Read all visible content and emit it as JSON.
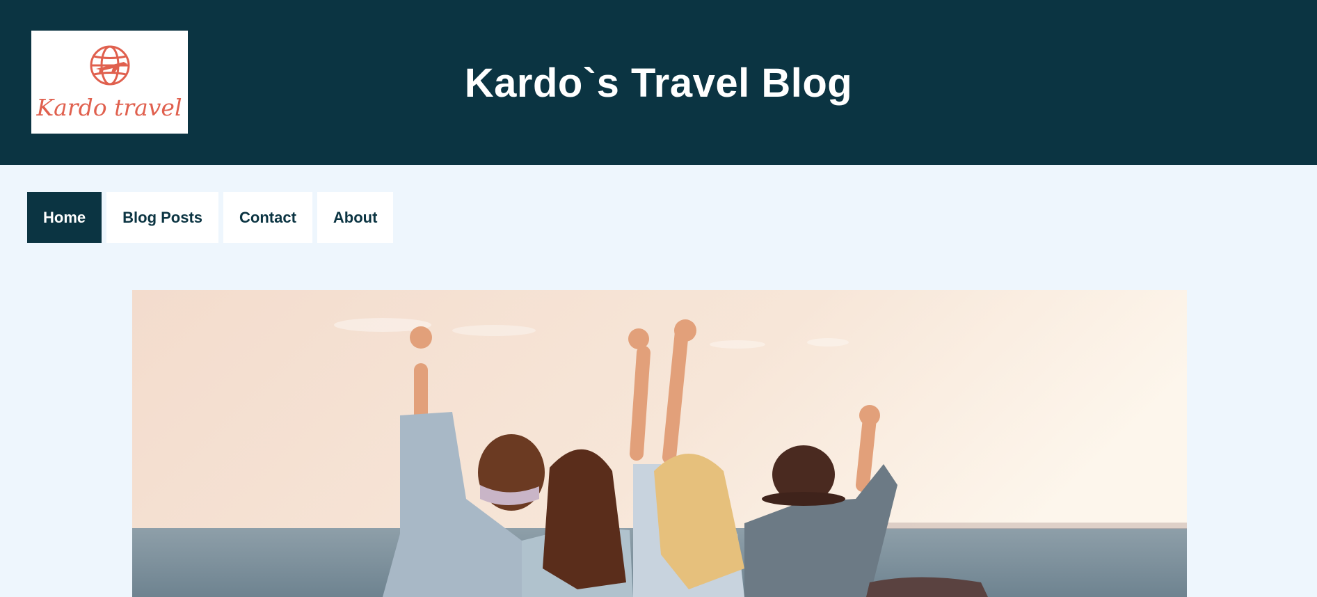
{
  "header": {
    "title": "Kardo`s Travel Blog",
    "background_color": "#0b3442",
    "logo": {
      "icon": "globe-airplane-icon",
      "text": "Kardo travel",
      "color": "#e0604e"
    }
  },
  "nav": {
    "items": [
      {
        "label": "Home",
        "active": true
      },
      {
        "label": "Blog Posts",
        "active": false
      },
      {
        "label": "Contact",
        "active": false
      },
      {
        "label": "About",
        "active": false
      }
    ]
  },
  "hero": {
    "icon": "friends-at-sea-photo"
  }
}
